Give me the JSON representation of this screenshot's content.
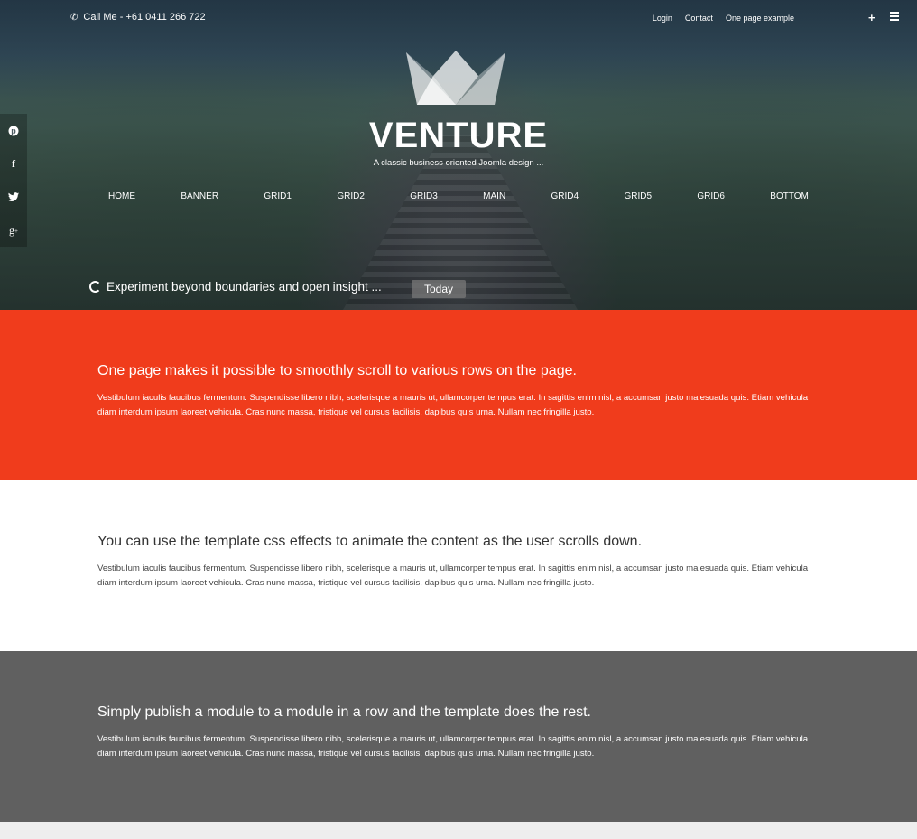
{
  "topbar": {
    "phone_icon": "phone-icon",
    "phone_text": "Call Me - +61 0411 266 722",
    "links": [
      "Login",
      "Contact",
      "One page example"
    ],
    "plus_label": "+",
    "menu_icon": "hamburger-icon"
  },
  "hero": {
    "title": "VENTURE",
    "tagline": "A classic business oriented Joomla design ...",
    "nav": [
      "HOME",
      "BANNER",
      "GRID1",
      "GRID2",
      "GRID3",
      "MAIN",
      "GRID4",
      "GRID5",
      "GRID6",
      "BOTTOM"
    ],
    "social": [
      "pinterest-icon",
      "facebook-icon",
      "twitter-icon",
      "google-plus-icon"
    ],
    "ticker_text": "Experiment beyond boundaries and open insight ...",
    "ticker_button": "Today"
  },
  "rows": [
    {
      "heading": "One page makes it possible to smoothly scroll to various rows on the page.",
      "body": "Vestibulum iaculis faucibus fermentum. Suspendisse libero nibh, scelerisque a mauris ut, ullamcorper tempus erat. In sagittis enim nisl, a accumsan justo malesuada quis. Etiam vehicula diam interdum ipsum laoreet vehicula. Cras nunc massa, tristique vel cursus facilisis, dapibus quis urna. Nullam nec fringilla justo.",
      "background": "#f03c1c"
    },
    {
      "heading": "You can use the template css effects to animate the content as the user scrolls down.",
      "body": "Vestibulum iaculis faucibus fermentum. Suspendisse libero nibh, scelerisque a mauris ut, ullamcorper tempus erat. In sagittis enim nisl, a accumsan justo malesuada quis. Etiam vehicula diam interdum ipsum laoreet vehicula. Cras nunc massa, tristique vel cursus facilisis, dapibus quis urna. Nullam nec fringilla justo.",
      "background": "#ffffff"
    },
    {
      "heading": "Simply publish a module to a module in a row and the template does the rest.",
      "body": "Vestibulum iaculis faucibus fermentum. Suspendisse libero nibh, scelerisque a mauris ut, ullamcorper tempus erat. In sagittis enim nisl, a accumsan justo malesuada quis. Etiam vehicula diam interdum ipsum laoreet vehicula. Cras nunc massa, tristique vel cursus facilisis, dapibus quis urna. Nullam nec fringilla justo.",
      "background": "#606060"
    }
  ]
}
